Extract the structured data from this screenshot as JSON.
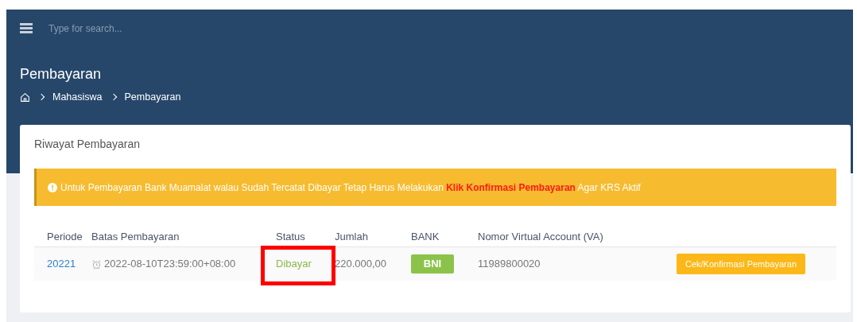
{
  "search": {
    "placeholder": "Type for search..."
  },
  "page_title": "Pembayaran",
  "breadcrumb": [
    "Mahasiswa",
    "Pembayaran"
  ],
  "card": {
    "title": "Riwayat Pembayaran",
    "alert": "Untuk Pembayaran Bank Muamalat walau Sudah Tercatat Dibayar Tetap Harus Melakukan **Klik Konfirmasi Pembayaran** Agar KRS Aktif",
    "table": {
      "columns": [
        "Periode",
        "Batas Pembayaran",
        "Status",
        "Jumlah",
        "BANK",
        "Nomor Virtual Account (VA)"
      ],
      "rows": [
        {
          "periode": "20221",
          "batas": "2022-08-10T23:59:00+08:00",
          "status": "Dibayar",
          "highlighted": true,
          "jumlah": "220.000,00",
          "bank": "BNI",
          "va": "11989800020",
          "action": "Cek/Konfirmasi Pembayaran"
        }
      ]
    }
  }
}
